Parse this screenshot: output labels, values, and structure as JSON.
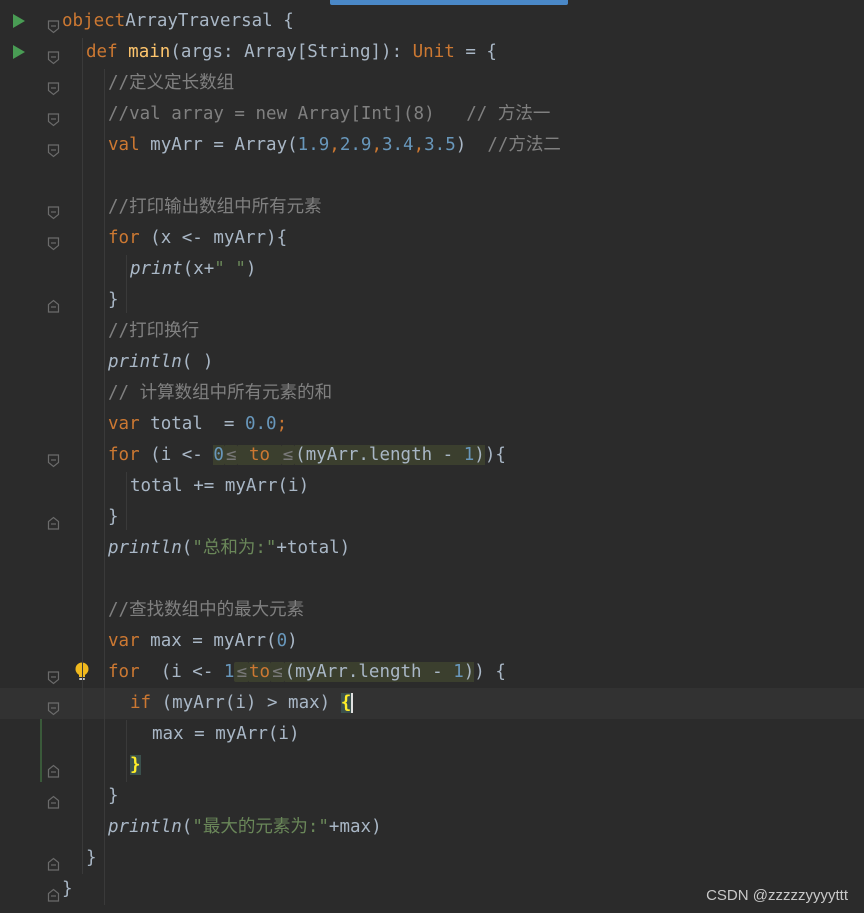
{
  "editor": {
    "lines": [
      {
        "segments": [
          [
            "kw",
            "object"
          ],
          [
            "",
            "ArrayTraversal {"
          ]
        ]
      },
      {
        "segments": [
          [
            "kw",
            "def "
          ],
          [
            "fn",
            "main"
          ],
          [
            "",
            "(args: Array[String]): "
          ],
          [
            "kw",
            "Unit"
          ],
          [
            "",
            " = {"
          ]
        ]
      },
      {
        "segments": [
          [
            "cmt",
            "//定义定长数组"
          ]
        ]
      },
      {
        "segments": [
          [
            "cmt",
            "//val array = new Array[Int](8)   // 方法一"
          ]
        ]
      },
      {
        "segments": [
          [
            "kw",
            "val "
          ],
          [
            "",
            "myArr = Array("
          ],
          [
            "num",
            "1.9"
          ],
          [
            "kw",
            ","
          ],
          [
            "num",
            "2.9"
          ],
          [
            "kw",
            ","
          ],
          [
            "num",
            "3.4"
          ],
          [
            "kw",
            ","
          ],
          [
            "num",
            "3.5"
          ],
          [
            "",
            ")  "
          ],
          [
            "cmt",
            "//方法二"
          ]
        ]
      },
      {
        "segments": []
      },
      {
        "segments": [
          [
            "cmt",
            "//打印输出数组中所有元素"
          ]
        ]
      },
      {
        "segments": [
          [
            "kw",
            "for "
          ],
          [
            "",
            "(x <- myArr){"
          ]
        ]
      },
      {
        "segments": [
          [
            "it",
            "print"
          ],
          [
            "",
            "(x+"
          ],
          [
            "str",
            "\" \""
          ],
          [
            "",
            ")"
          ]
        ]
      },
      {
        "segments": [
          [
            "",
            "}"
          ]
        ]
      },
      {
        "segments": [
          [
            "cmt",
            "//打印换行"
          ]
        ]
      },
      {
        "segments": [
          [
            "it",
            "println"
          ],
          [
            "",
            "( )"
          ]
        ]
      },
      {
        "segments": [
          [
            "cmt",
            "// 计算数组中所有元素的和"
          ]
        ]
      },
      {
        "segments": [
          [
            "kw",
            "var "
          ],
          [
            "",
            "total  = "
          ],
          [
            "num",
            "0.0"
          ],
          [
            "kw",
            ";"
          ]
        ]
      },
      {
        "segments": [
          [
            "kw",
            "for "
          ],
          [
            "",
            "(i <- "
          ],
          [
            "hintnum",
            "0"
          ],
          [
            "hint",
            "≤"
          ],
          [
            "hintkw",
            " to "
          ],
          [
            "hint",
            "≤"
          ],
          [
            "hintplain",
            "(myArr.length - "
          ],
          [
            "hintnum",
            "1"
          ],
          [
            "hintplain",
            ")"
          ],
          [
            "",
            "){"
          ]
        ]
      },
      {
        "segments": [
          [
            "",
            "total += myArr(i)"
          ]
        ]
      },
      {
        "segments": [
          [
            "",
            "}"
          ]
        ]
      },
      {
        "segments": [
          [
            "it",
            "println"
          ],
          [
            "",
            "("
          ],
          [
            "str",
            "\"总和为:\""
          ],
          [
            "",
            "+total)"
          ]
        ]
      },
      {
        "segments": []
      },
      {
        "segments": [
          [
            "cmt",
            "//查找数组中的最大元素"
          ]
        ]
      },
      {
        "segments": [
          [
            "kw",
            "var "
          ],
          [
            "",
            "max = myArr("
          ],
          [
            "num",
            "0"
          ],
          [
            "",
            ")"
          ]
        ]
      },
      {
        "segments": [
          [
            "kw",
            "for  "
          ],
          [
            "",
            "(i <- "
          ],
          [
            "num",
            "1"
          ],
          [
            "hint",
            "≤"
          ],
          [
            "",
            ""
          ],
          [
            "hintkw",
            "to"
          ],
          [
            "hint",
            "≤"
          ],
          [
            "hintplain",
            "(myArr.length - "
          ],
          [
            "hintnum",
            "1"
          ],
          [
            "hintplain",
            ")"
          ],
          [
            "",
            ") {"
          ]
        ]
      },
      {
        "segments": [
          [
            "kw",
            "if "
          ],
          [
            "",
            "(myArr(i) > max) "
          ],
          [
            "bracehl",
            "{"
          ],
          [
            "caret",
            ""
          ]
        ]
      },
      {
        "segments": [
          [
            "",
            "max = myArr(i)"
          ]
        ]
      },
      {
        "segments": [
          [
            "bracehl",
            "}"
          ]
        ]
      },
      {
        "segments": [
          [
            "",
            "}"
          ]
        ]
      },
      {
        "segments": [
          [
            "it",
            "println"
          ],
          [
            "",
            "("
          ],
          [
            "str",
            "\"最大的元素为:\""
          ],
          [
            "",
            "+max)"
          ]
        ]
      },
      {
        "segments": [
          [
            "",
            "}"
          ]
        ]
      },
      {
        "segments": [
          [
            "",
            "}"
          ]
        ]
      }
    ]
  },
  "watermark": "CSDN @zzzzzyyyyttt",
  "colors": {
    "background": "#2b2b2b",
    "keyword": "#cc7832",
    "function": "#ffc66d",
    "number": "#6897bb",
    "string": "#6a8759",
    "comment": "#808080",
    "run": "#499c54"
  },
  "icons": [
    "run-icon",
    "fold-icon",
    "bulb-icon"
  ]
}
